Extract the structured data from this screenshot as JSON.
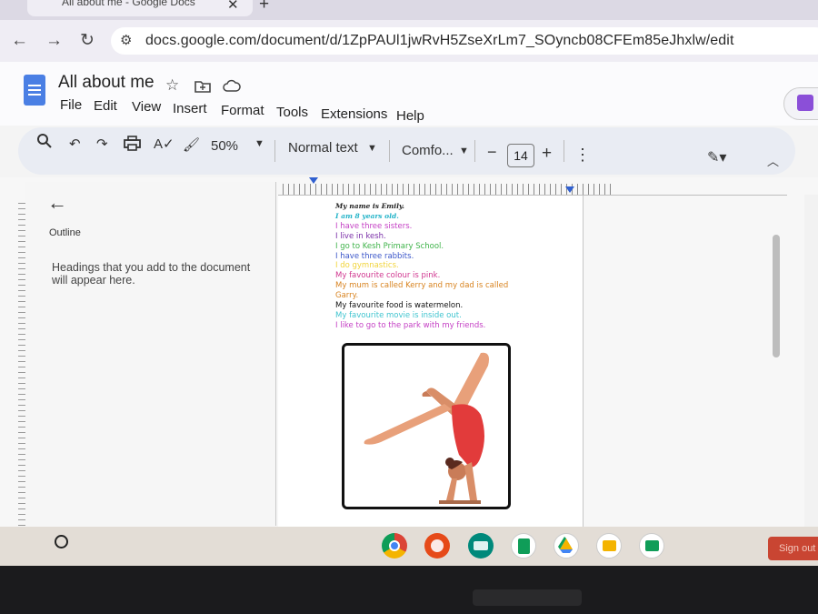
{
  "browser": {
    "tab_title": "All about me - Google Docs",
    "tab_close": "✕",
    "new_tab": "+",
    "url": "docs.google.com/document/d/1ZpPAUl1jwRvH5ZseXrLm7_SOyncb08CFEm85eJhxlw/edit"
  },
  "doc": {
    "title": "All about me",
    "menu": [
      "File",
      "Edit",
      "View",
      "Insert",
      "Format",
      "Tools",
      "Extensions",
      "Help"
    ]
  },
  "toolbar": {
    "zoom": "50%",
    "style": "Normal text",
    "font": "Comfo...",
    "font_size": "14",
    "decrease": "−",
    "increase": "+"
  },
  "outline": {
    "label": "Outline",
    "hint": "Headings that you add to the document will appear here."
  },
  "document_lines": [
    {
      "text": "My name is Emily.",
      "color": "#222222",
      "style": "script"
    },
    {
      "text": "I am 8 years old.",
      "color": "#22b3c8",
      "style": "script"
    },
    {
      "text": "I have three sisters.",
      "color": "#c43fc4",
      "style": "normal"
    },
    {
      "text": "I live in kesh.",
      "color": "#7a2fa8",
      "style": "normal"
    },
    {
      "text": "I go to Kesh Primary School.",
      "color": "#3fb34a",
      "style": "normal"
    },
    {
      "text": "I have three rabbits.",
      "color": "#3b56c9",
      "style": "normal"
    },
    {
      "text": "I do gymnastics.",
      "color": "#f1d43a",
      "style": "normal"
    },
    {
      "text": "My favourite colour is pink.",
      "color": "#d0368f",
      "style": "normal"
    },
    {
      "text": "My mum is called Kerry and my dad is called",
      "color": "#d8831f",
      "style": "normal"
    },
    {
      "text": "Garry.",
      "color": "#d8831f",
      "style": "normal"
    },
    {
      "text": "My favourite food is watermelon.",
      "color": "#111111",
      "style": "normal"
    },
    {
      "text": "My favourite movie is inside out.",
      "color": "#3fc4cf",
      "style": "normal"
    },
    {
      "text": "I like to go to the park with my friends.",
      "color": "#c43fc4",
      "style": "normal"
    }
  ],
  "taskbar": {
    "apps": [
      "chrome-icon",
      "canvas-icon",
      "reader-icon",
      "sheets-icon",
      "drive-icon",
      "slides-icon",
      "classroom-icon"
    ],
    "signout_label": "Sign out"
  }
}
